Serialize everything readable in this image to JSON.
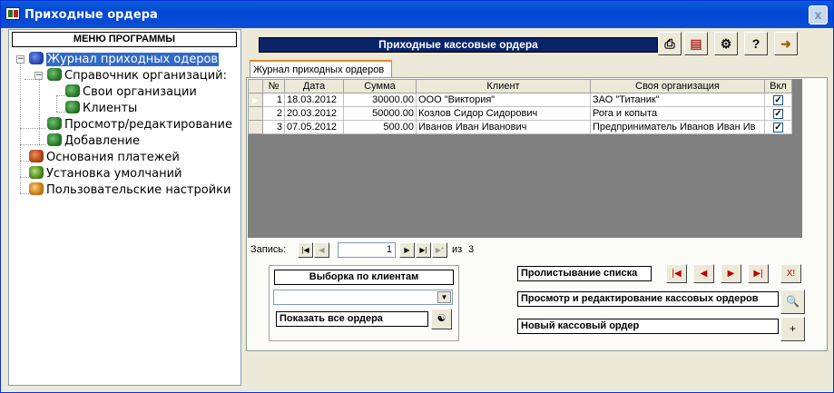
{
  "window": {
    "title": "Приходные ордера",
    "close_label": "x"
  },
  "left": {
    "menu_header": "МЕНЮ ПРОГРАММЫ",
    "tree": [
      {
        "label": "Журнал приходных одеров",
        "icon": "car-icon",
        "level": 0,
        "selected": true,
        "expanded": true
      },
      {
        "label": "Справочник организаций:",
        "icon": "gear-icon",
        "level": 1,
        "expanded": true
      },
      {
        "label": "Свои организации",
        "icon": "gear-icon",
        "level": 2
      },
      {
        "label": "Клиенты",
        "icon": "gear-icon",
        "level": 2
      },
      {
        "label": "Просмотр/редактирование",
        "icon": "gear-icon",
        "level": 1
      },
      {
        "label": "Добавление",
        "icon": "gear-icon",
        "level": 1
      },
      {
        "label": "Основания платежей",
        "icon": "car-icon",
        "level": 0
      },
      {
        "label": "Установка умолчаний",
        "icon": "car-icon",
        "level": 0
      },
      {
        "label": "Пользовательские настройки",
        "icon": "car-icon",
        "level": 0
      }
    ]
  },
  "main": {
    "header": "Приходные кассовые ордера",
    "toolbar_icons": [
      "printer-icon",
      "report-icon",
      "settings-icon",
      "help-icon",
      "exit-icon"
    ],
    "tab": "Журнал приходных ордеров",
    "grid": {
      "columns": [
        "№",
        "Дата",
        "Сумма",
        "Клиент",
        "Своя организация",
        "Вкл"
      ],
      "rows": [
        {
          "num": "1",
          "date": "18.03.2012",
          "sum": "30000.00",
          "client": "ООО \"Виктория\"",
          "org": "ЗАО \"Титаник\"",
          "checked": true,
          "current": true
        },
        {
          "num": "2",
          "date": "20.03.2012",
          "sum": "50000.00",
          "client": "Козлов Сидор Сидорович",
          "org": "Рога и копыта",
          "checked": true
        },
        {
          "num": "3",
          "date": "07.05.2012",
          "sum": "500.00",
          "client": "Иванов Иван Иванович",
          "org": "Предприниматель Иванов Иван Ив",
          "checked": true
        }
      ]
    },
    "record_nav": {
      "label": "Запись:",
      "current": "1",
      "of_label": "из",
      "total": "3"
    },
    "filter": {
      "title": "Выборка по клиентам",
      "combo_value": "",
      "show_all": "Показать все ордера"
    },
    "scroll_label": "Пролистывание списка",
    "view_edit_label": "Просмотр и редактирование кассовых ордеров",
    "new_label": "Новый кассовый ордер"
  }
}
